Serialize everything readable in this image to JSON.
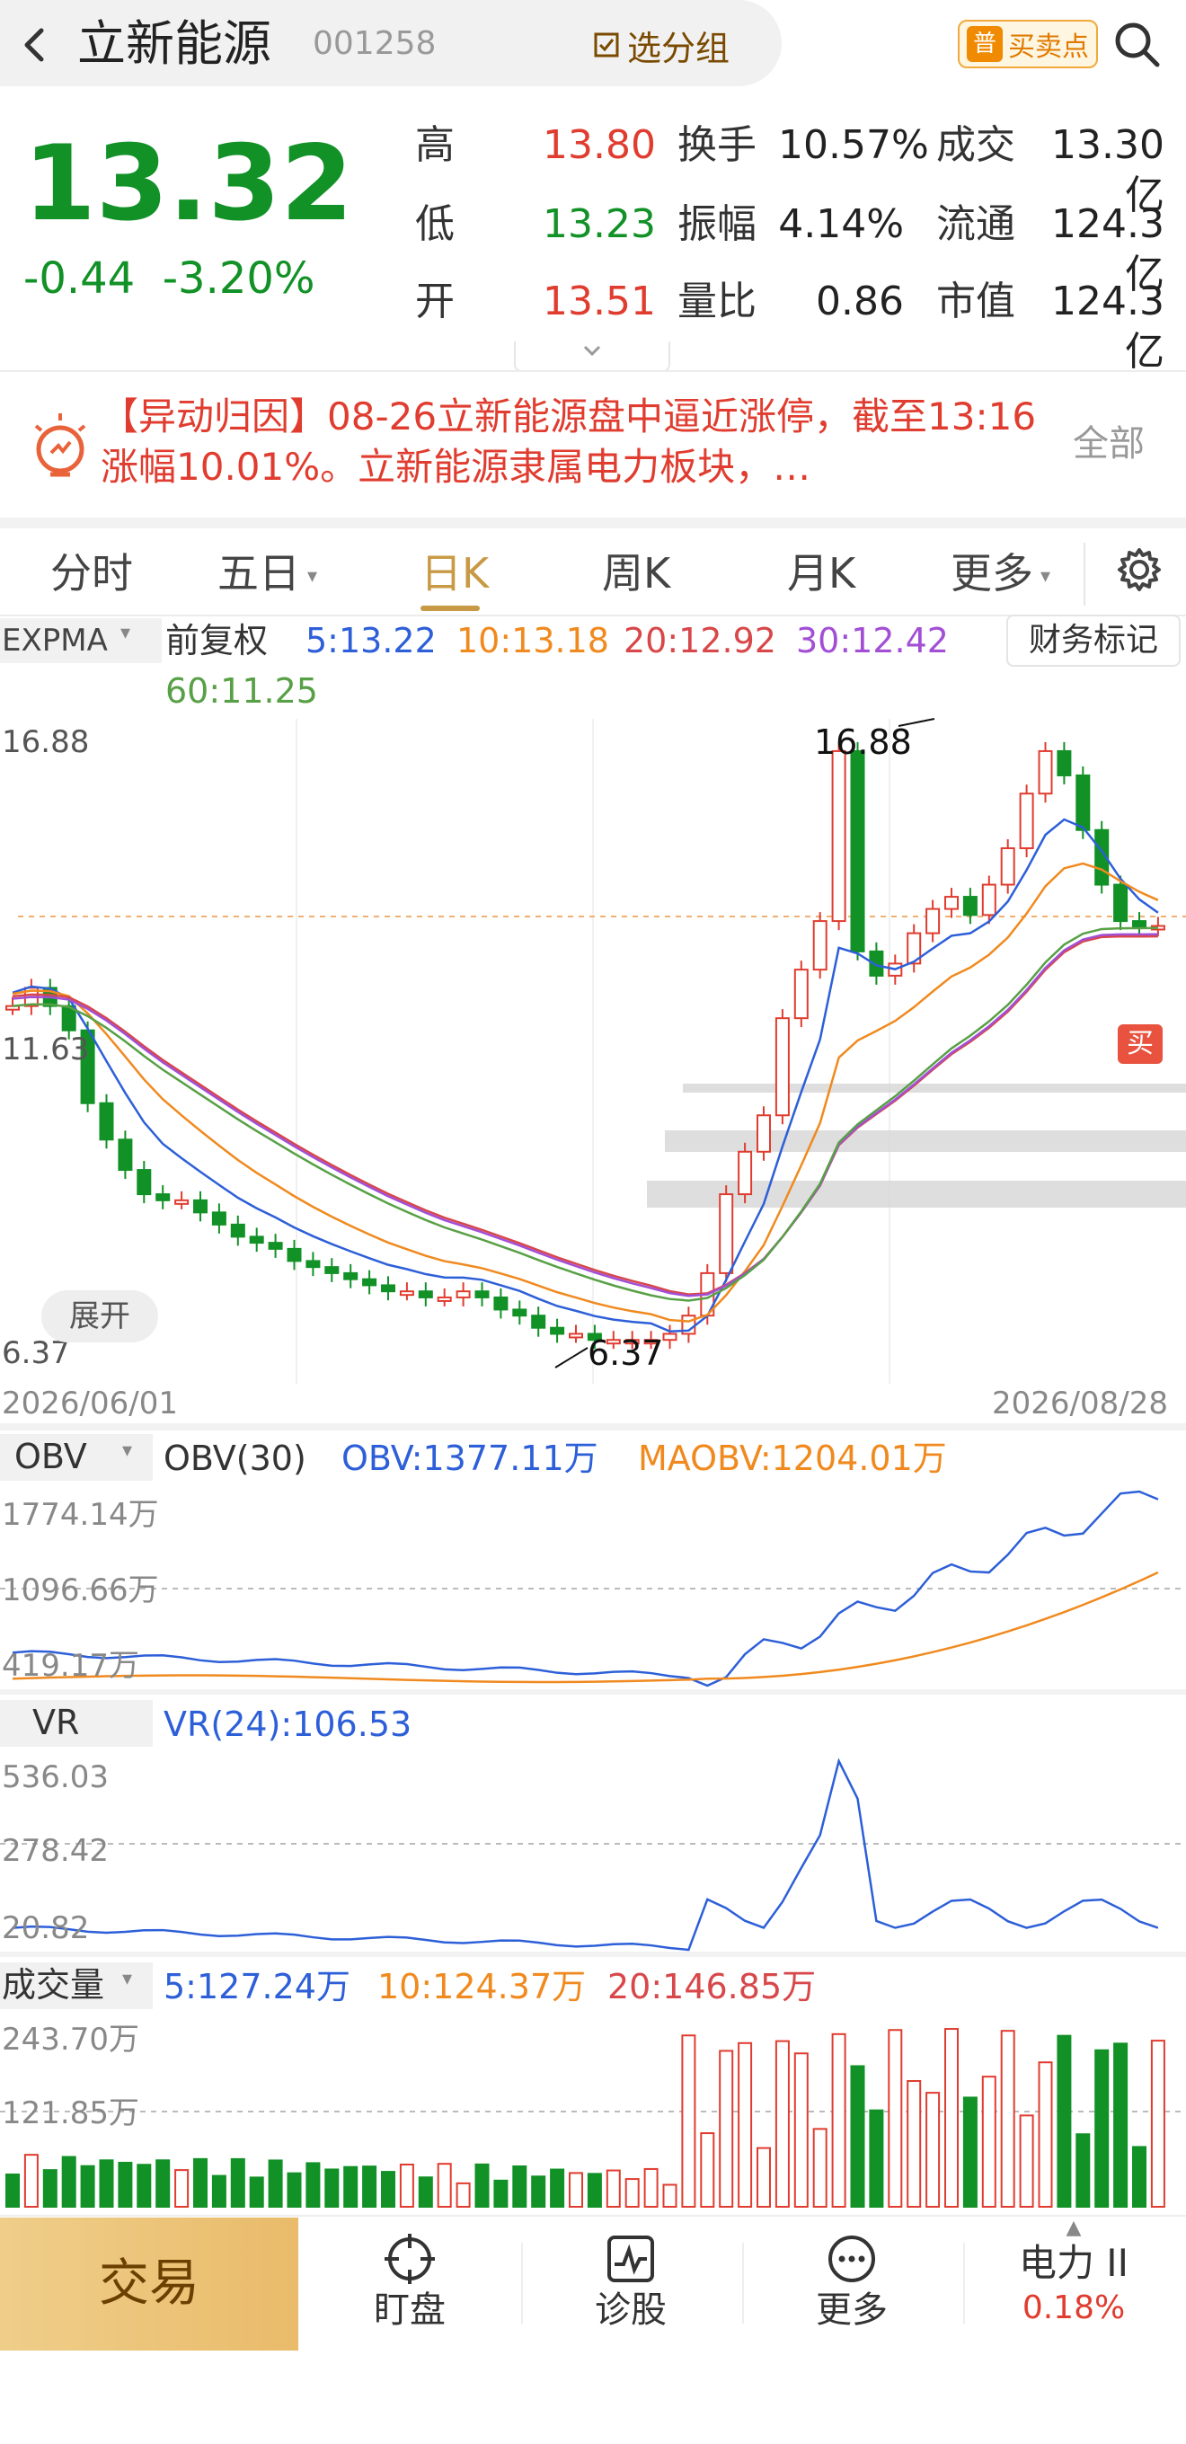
{
  "header": {
    "back_icon": "chevron-left-icon",
    "stock_name": "立新能源",
    "stock_code": "001258",
    "watchlist_label": "选分组",
    "bs_point_badge": "普",
    "bs_point_label": "买卖点",
    "search_icon": "search-icon"
  },
  "quote": {
    "price": "13.32",
    "change": "-0.44",
    "change_pct": "-3.20%",
    "high_label": "高",
    "high": "13.80",
    "low_label": "低",
    "low": "13.23",
    "open_label": "开",
    "open": "13.51",
    "turnover_label": "换手",
    "turnover": "10.57%",
    "amplitude_label": "振幅",
    "amplitude": "4.14%",
    "vol_ratio_label": "量比",
    "vol_ratio": "0.86",
    "amount_label": "成交",
    "amount": "13.30亿",
    "float_cap_label": "流通",
    "float_cap": "124.3亿",
    "mkt_cap_label": "市值",
    "mkt_cap": "124.3亿",
    "colors": {
      "up": "#e03c2f",
      "down": "#119126"
    }
  },
  "news": {
    "icon": "lightbulb-icon",
    "text": "【异动归因】08-26立新能源盘中逼近涨停，截至13:16涨幅10.01%。立新能源隶属电力板块，…",
    "all_label": "全部"
  },
  "tabs": {
    "items": [
      "分时",
      "五日",
      "日K",
      "周K",
      "月K",
      "更多"
    ],
    "active": "日K",
    "settings_icon": "gear-icon"
  },
  "kline": {
    "indicator_name": "EXPMA",
    "adjust_label": "前复权",
    "ma_labels": [
      {
        "text": "5:13.22",
        "color": "#2d5fd8"
      },
      {
        "text": "10:13.18",
        "color": "#f08a1f"
      },
      {
        "text": "20:12.92",
        "color": "#d8474a"
      },
      {
        "text": "30:12.42",
        "color": "#a24fd6"
      },
      {
        "text": "60:11.25",
        "color": "#58a046"
      }
    ],
    "finance_mark_label": "财务标记",
    "axis_top": "16.88",
    "axis_mid": "11.63",
    "axis_bottom": "6.37",
    "high_marker": "16.88",
    "low_marker": "6.37",
    "date_start": "2026/06/01",
    "date_end": "2026/08/28",
    "expand_label": "展开",
    "buy_marker": "买"
  },
  "obv": {
    "name": "OBV",
    "param": "OBV(30)",
    "value_label": "OBV:1377.11万",
    "ma_label": "MAOBV:1204.01万",
    "axis_top": "1774.14万",
    "axis_mid": "1096.66万",
    "axis_bottom": "419.17万"
  },
  "vr": {
    "name": "VR",
    "value_label": "VR(24):106.53",
    "axis_top": "536.03",
    "axis_mid": "278.42",
    "axis_bottom": "20.82"
  },
  "volume": {
    "name": "成交量",
    "ma5": "5:127.24万",
    "ma10": "10:124.37万",
    "ma20": "20:146.85万",
    "axis_top": "243.70万",
    "axis_mid": "121.85万"
  },
  "bottom_nav": {
    "trade": "交易",
    "items": [
      {
        "label": "盯盘",
        "icon": "crosshair-icon"
      },
      {
        "label": "诊股",
        "icon": "pulse-chart-icon"
      },
      {
        "label": "更多",
        "icon": "more-dots-icon"
      }
    ],
    "sector_name": "电力 II",
    "sector_change": "0.18%"
  }
}
